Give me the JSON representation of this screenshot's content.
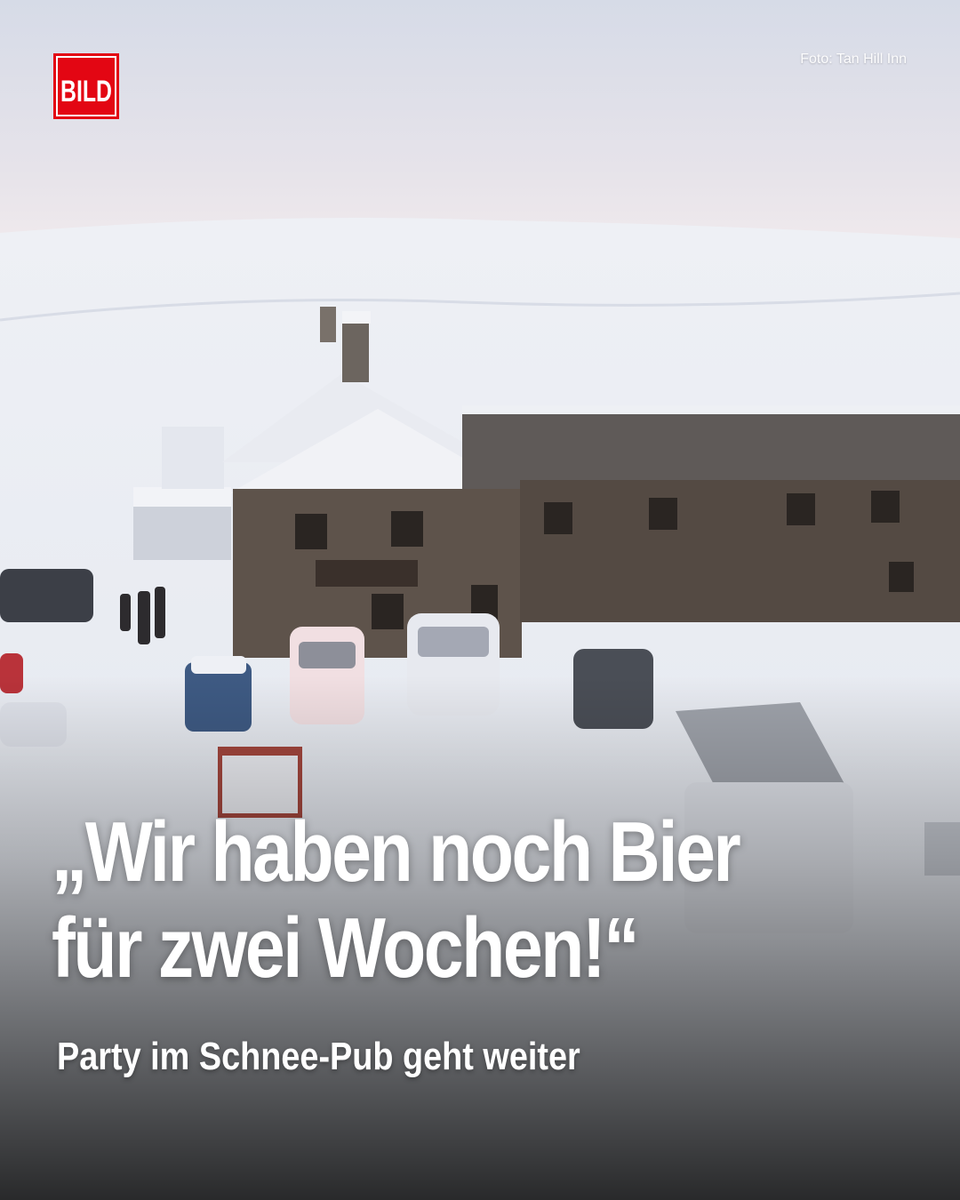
{
  "brand": {
    "logo_text": "BILD",
    "color": "#e30613"
  },
  "photo": {
    "credit": "Foto: Tan Hill Inn",
    "subject": "snow-covered-pub-aerial-photo"
  },
  "headline": {
    "line1": "„Wir haben noch Bier",
    "line2": "für zwei Wochen!“"
  },
  "subline": "Party im Schnee-Pub geht weiter"
}
